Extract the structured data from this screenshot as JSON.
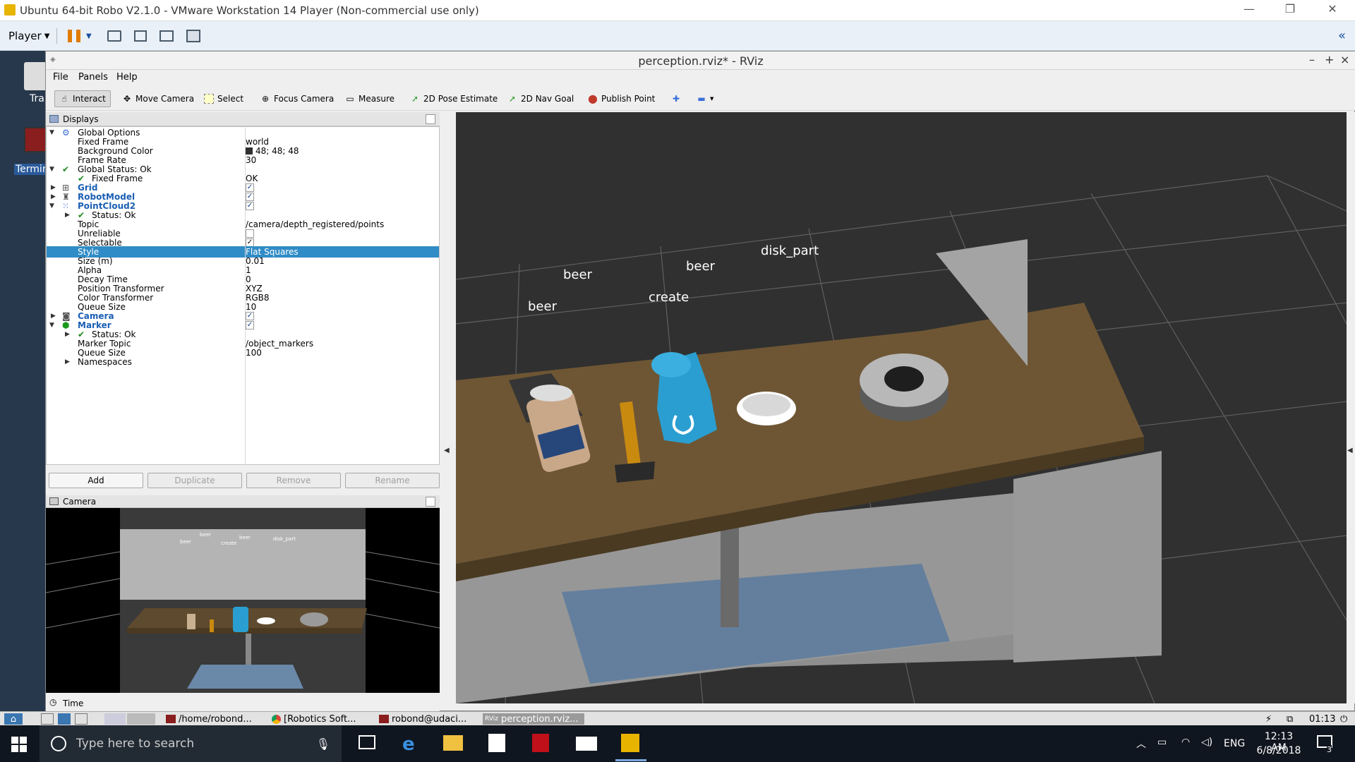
{
  "vmware": {
    "title": "Ubuntu 64-bit Robo V2.1.0 - VMware Workstation 14 Player (Non-commercial use only)",
    "player_label": "Player",
    "window_controls": [
      "—",
      "❐",
      "✕"
    ]
  },
  "desktop": {
    "icon1_label": "Tra",
    "icon2_label": "Termin"
  },
  "rviz": {
    "title": "perception.rviz* - RViz",
    "window_controls": [
      "–",
      "+",
      "×"
    ],
    "menu": [
      "File",
      "Panels",
      "Help"
    ],
    "tools": [
      {
        "label": "Interact",
        "icon": "hand-icon"
      },
      {
        "label": "Move Camera",
        "icon": "move-icon"
      },
      {
        "label": "Select",
        "icon": "select-icon"
      },
      {
        "label": "Focus Camera",
        "icon": "focus-icon"
      },
      {
        "label": "Measure",
        "icon": "ruler-icon"
      },
      {
        "label": "2D Pose Estimate",
        "icon": "arrow-green-icon"
      },
      {
        "label": "2D Nav Goal",
        "icon": "arrow-green-icon"
      },
      {
        "label": "Publish Point",
        "icon": "pin-icon"
      }
    ],
    "displays": {
      "header": "Displays",
      "rows": [
        {
          "key": "Global Options",
          "value": ""
        },
        {
          "key": "Fixed Frame",
          "value": "world"
        },
        {
          "key": "Background Color",
          "value": "48; 48; 48"
        },
        {
          "key": "Frame Rate",
          "value": "30"
        },
        {
          "key": "Global Status: Ok",
          "value": ""
        },
        {
          "key": "Fixed Frame",
          "value": "OK"
        },
        {
          "key": "Grid",
          "value": ""
        },
        {
          "key": "RobotModel",
          "value": ""
        },
        {
          "key": "PointCloud2",
          "value": ""
        },
        {
          "key": "Status: Ok",
          "value": ""
        },
        {
          "key": "Topic",
          "value": "/camera/depth_registered/points"
        },
        {
          "key": "Unreliable",
          "value": ""
        },
        {
          "key": "Selectable",
          "value": ""
        },
        {
          "key": "Style",
          "value": "Flat Squares"
        },
        {
          "key": "Size (m)",
          "value": "0.01"
        },
        {
          "key": "Alpha",
          "value": "1"
        },
        {
          "key": "Decay Time",
          "value": "0"
        },
        {
          "key": "Position Transformer",
          "value": "XYZ"
        },
        {
          "key": "Color Transformer",
          "value": "RGB8"
        },
        {
          "key": "Queue Size",
          "value": "10"
        },
        {
          "key": "Camera",
          "value": ""
        },
        {
          "key": "Marker",
          "value": ""
        },
        {
          "key": "Status: Ok",
          "value": ""
        },
        {
          "key": "Marker Topic",
          "value": "/object_markers"
        },
        {
          "key": "Queue Size",
          "value": "100"
        },
        {
          "key": "Namespaces",
          "value": ""
        }
      ]
    },
    "buttons": [
      "Add",
      "Duplicate",
      "Remove",
      "Rename"
    ],
    "camera_panel": {
      "header": "Camera",
      "labels": [
        "beer",
        "beer",
        "beer",
        "create",
        "disk_part"
      ]
    },
    "time_label": "Time",
    "scene_labels": [
      "beer",
      "beer",
      "beer",
      "create",
      "disk_part"
    ]
  },
  "ubuntu_taskbar": {
    "tasks": [
      "/home/robond...",
      "[Robotics Soft...",
      "robond@udaci...",
      "perception.rviz..."
    ],
    "clock": "01:13"
  },
  "windows_taskbar": {
    "search_placeholder": "Type here to search",
    "lang": "ENG",
    "time": "12:13 AM",
    "date": "6/8/2018",
    "notification_count": "3"
  },
  "colors": {
    "selection": "#308cc6",
    "view_background": "#303030",
    "link_blue": "#1a5fb4"
  }
}
